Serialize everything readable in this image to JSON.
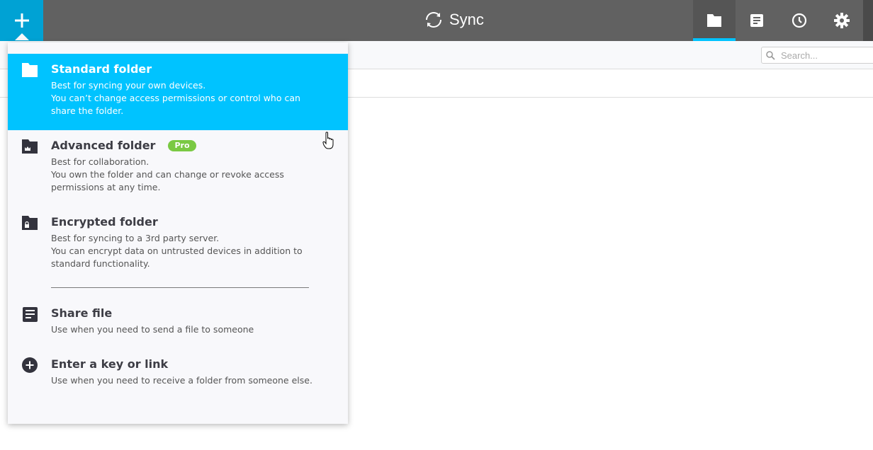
{
  "app": {
    "title": "Sync",
    "accent_color": "#00c3ff",
    "add_button_color": "#00a2d4"
  },
  "topbar": {
    "add_button_icon": "plus-icon",
    "nav": [
      {
        "name": "folders",
        "icon": "folder-icon",
        "active": true
      },
      {
        "name": "transfers",
        "icon": "document-icon",
        "active": false
      },
      {
        "name": "history",
        "icon": "clock-icon",
        "active": false
      },
      {
        "name": "settings",
        "icon": "gear-icon",
        "active": false
      }
    ]
  },
  "toolbar": {
    "search_placeholder": "Search...",
    "search_value": ""
  },
  "menu": {
    "items": [
      {
        "id": "standard-folder",
        "icon": "folder-icon",
        "title": "Standard folder",
        "desc": "Best for syncing your own devices.\nYou can’t change access permissions or control who can share the folder.",
        "active": true
      },
      {
        "id": "advanced-folder",
        "icon": "folder-crown-icon",
        "title": "Advanced folder",
        "badge": "Pro",
        "badge_color": "#7ac943",
        "desc": "Best for collaboration.\nYou own the folder and can change or revoke access permissions at any time."
      },
      {
        "id": "encrypted-folder",
        "icon": "folder-lock-icon",
        "title": "Encrypted folder",
        "desc": "Best for syncing to a 3rd party server.\nYou can encrypt data on untrusted devices in addition to standard functionality."
      },
      {
        "id": "share-file",
        "icon": "file-icon",
        "title": "Share file",
        "desc": "Use when you need to send a file to someone"
      },
      {
        "id": "enter-key",
        "icon": "plus-circle-icon",
        "title": "Enter a key or link",
        "desc": "Use when you need to receive a folder from someone else."
      }
    ]
  }
}
